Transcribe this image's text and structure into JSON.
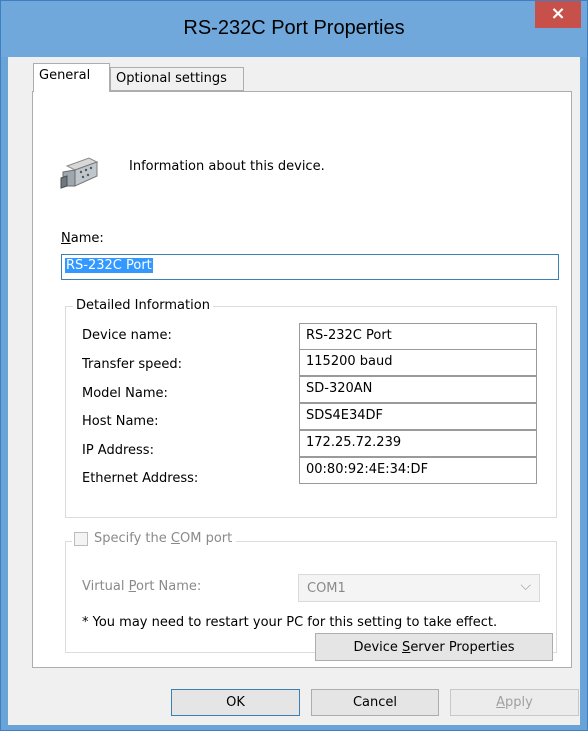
{
  "window": {
    "title": "RS-232C Port Properties",
    "close_label": "×"
  },
  "tabs": [
    {
      "label": "General",
      "active": true
    },
    {
      "label": "Optional settings",
      "active": false
    }
  ],
  "general": {
    "info_text": "Information about this device.",
    "name_label_first": "N",
    "name_label_rest": "ame:",
    "name_value": "RS-232C Port",
    "detailed": {
      "title": "Detailed Information",
      "rows": [
        {
          "label": "Device name:",
          "value": "RS-232C Port"
        },
        {
          "label": "Transfer speed:",
          "value": "115200 baud"
        },
        {
          "label": "Model Name:",
          "value": "SD-320AN"
        },
        {
          "label": "Host Name:",
          "value": "SDS4E34DF"
        },
        {
          "label": "IP Address:",
          "value": "172.25.72.239"
        },
        {
          "label": "Ethernet Address:",
          "value": "00:80:92:4E:34:DF"
        }
      ]
    },
    "com": {
      "checkbox_label_pre": "Specify the ",
      "checkbox_label_u": "C",
      "checkbox_label_post": "OM port",
      "checked": false,
      "vport_label_pre": "Virtual ",
      "vport_label_u": "P",
      "vport_label_post": "ort Name:",
      "vport_value": "COM1",
      "note": "* You may need to restart your PC for this setting to take effect."
    },
    "device_server_btn_pre": "Device ",
    "device_server_btn_u": "S",
    "device_server_btn_post": "erver Properties"
  },
  "buttons": {
    "ok": "OK",
    "cancel": "Cancel",
    "apply_u": "A",
    "apply_rest": "pply"
  },
  "colors": {
    "titlebar": "#71a8dc",
    "close_button": "#c7504a",
    "selection": "#3399ff"
  }
}
